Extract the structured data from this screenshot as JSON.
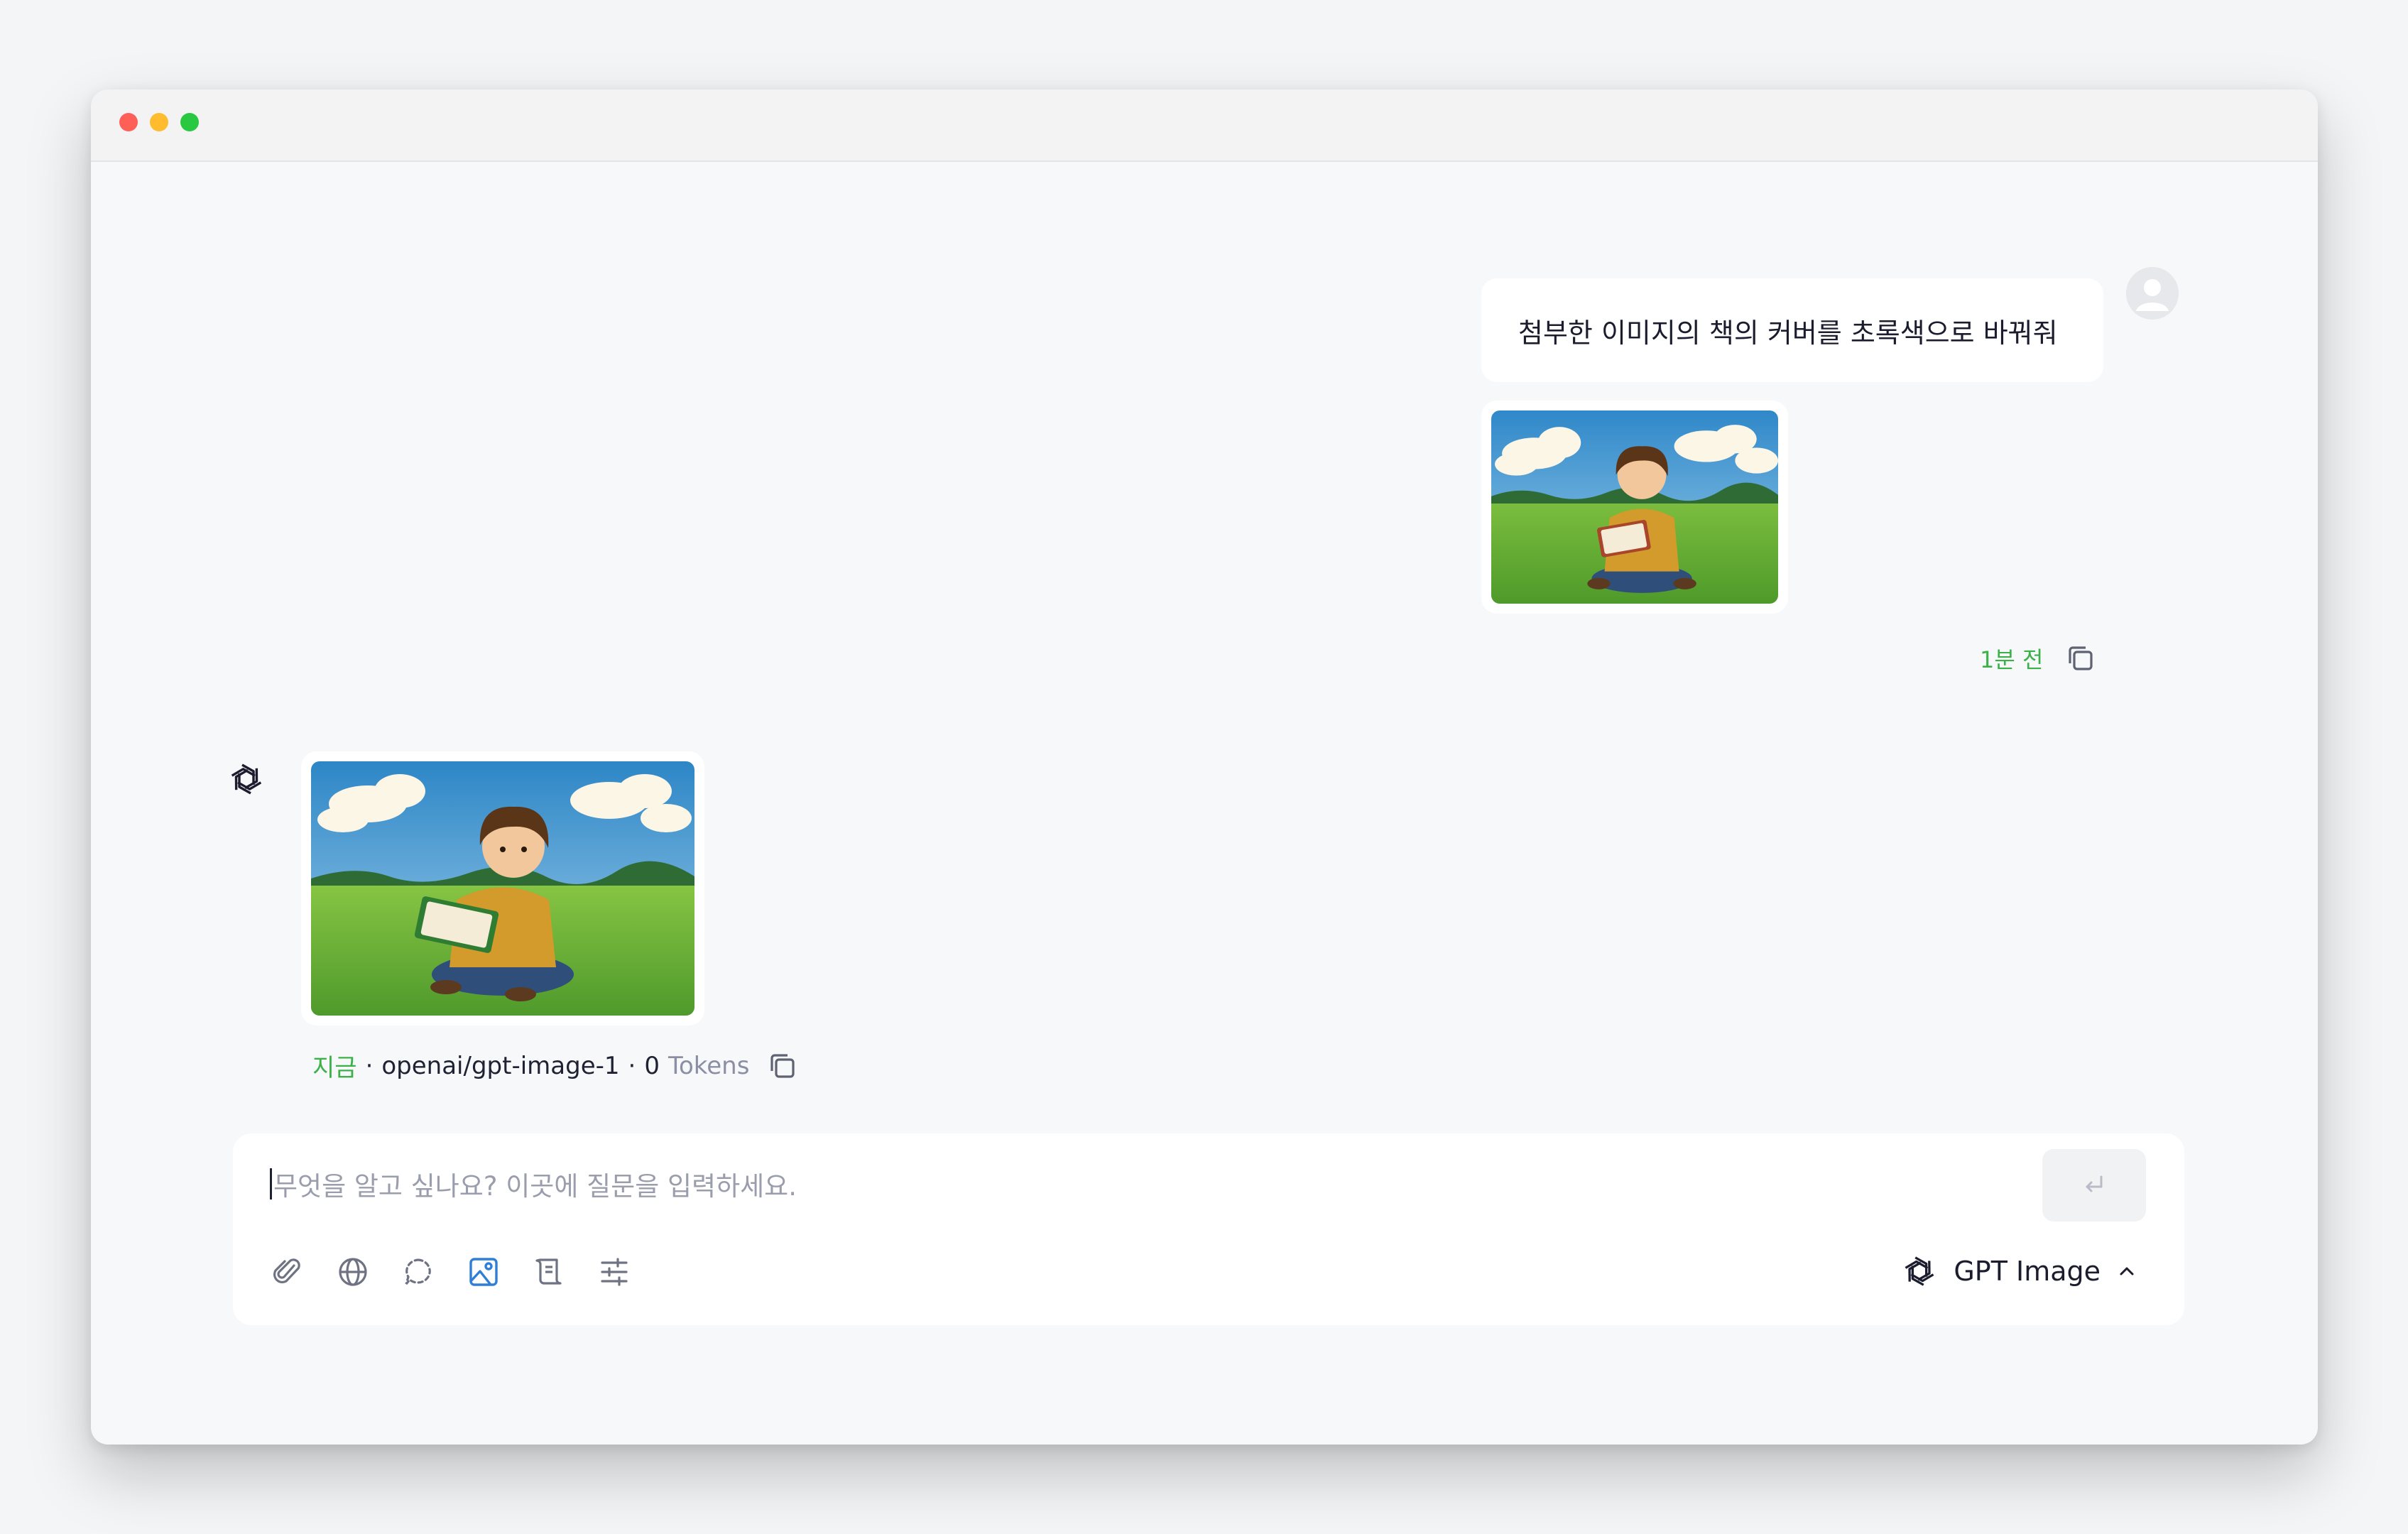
{
  "window": {
    "controls": [
      "close",
      "minimize",
      "maximize"
    ]
  },
  "conversation": {
    "user_message": {
      "text": "첨부한 이미지의 책의 커버를 초록색으로 바꿔줘",
      "attachment": "boy reading book in meadow illustration",
      "time": "1분 전",
      "copy_icon": "copy-icon"
    },
    "assistant_message": {
      "image": "boy reading green book in meadow illustration",
      "time": "지금",
      "separator": "·",
      "model": "openai/gpt-image-1",
      "token_count": "0",
      "token_label": "Tokens",
      "copy_icon": "copy-icon"
    }
  },
  "composer": {
    "placeholder": "무엇을 알고 싶나요? 이곳에 질문을 입력하세요.",
    "send_icon": "enter-return-icon",
    "tools": [
      "paperclip-icon",
      "globe-icon",
      "dashed-chat-icon",
      "image-icon",
      "scroll-icon",
      "sliders-icon"
    ],
    "model_label": "GPT Image",
    "model_icon": "openai-logo-icon"
  },
  "colors": {
    "accent_green": "#3cb14a",
    "active_tool_blue": "#2f7fd8",
    "background": "#f7f8fa"
  }
}
